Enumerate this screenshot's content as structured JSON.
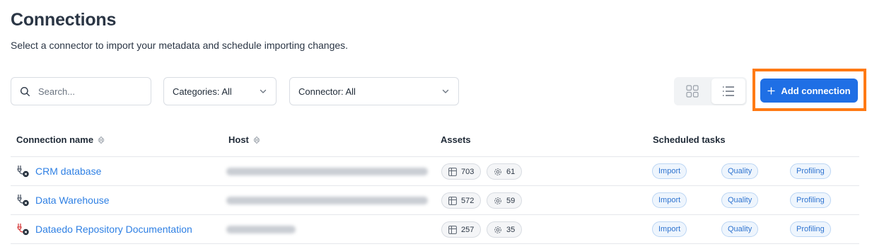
{
  "header": {
    "title": "Connections",
    "subtitle": "Select a connector to import your metadata and schedule importing changes."
  },
  "toolbar": {
    "search_placeholder": "Search...",
    "categories_filter": "Categories: All",
    "connector_filter": "Connector: All",
    "view_modes": [
      "grid-icon",
      "list-icon"
    ],
    "active_view": "list",
    "add_button_label": "Add connection",
    "accent_color": "#1f6fe5",
    "highlight_color": "#ff7a14"
  },
  "table": {
    "columns": [
      "Connection name",
      "Host",
      "Assets",
      "Scheduled tasks"
    ],
    "rows": [
      {
        "name": "CRM database",
        "icon": "connector-plug-icon",
        "host_blurred": true,
        "tables": "703",
        "procedures": "61",
        "tasks": [
          "Import",
          "Quality",
          "Profiling"
        ]
      },
      {
        "name": "Data Warehouse",
        "icon": "connector-plug-icon",
        "host_blurred": true,
        "tables": "572",
        "procedures": "59",
        "tasks": [
          "Import",
          "Quality",
          "Profiling"
        ]
      },
      {
        "name": "Dataedo Repository Documentation",
        "icon": "connector-plug-red-icon",
        "host_blurred": true,
        "tables": "257",
        "procedures": "35",
        "tasks": [
          "Import",
          "Quality",
          "Profiling"
        ]
      }
    ]
  }
}
